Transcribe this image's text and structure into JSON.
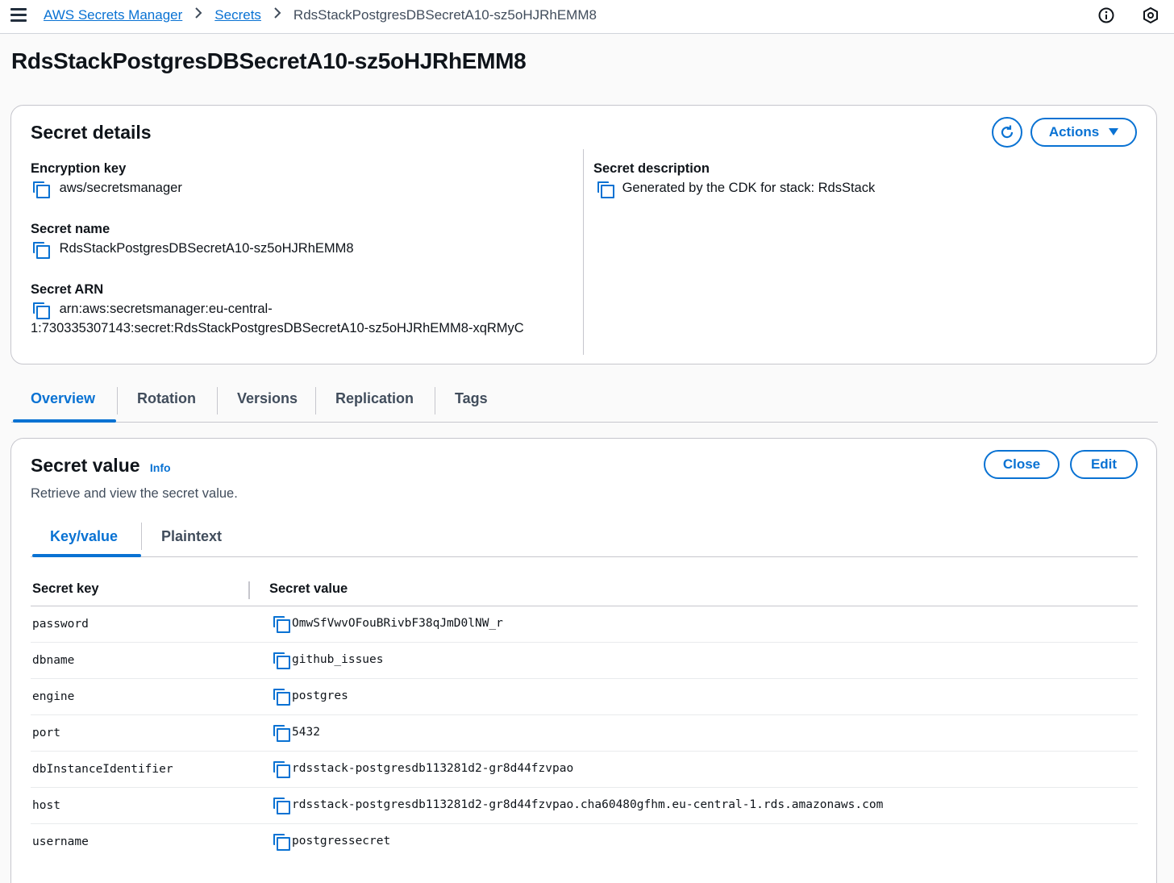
{
  "breadcrumb": {
    "root": "AWS Secrets Manager",
    "secrets": "Secrets",
    "current": "RdsStackPostgresDBSecretA10-sz5oHJRhEMM8"
  },
  "top_icons": [
    "info-circle-icon",
    "shield-hexagon-icon"
  ],
  "page_title": "RdsStackPostgresDBSecretA10-sz5oHJRhEMM8",
  "details": {
    "title": "Secret details",
    "actions_label": "Actions",
    "encryption_key_label": "Encryption key",
    "encryption_key_value": "aws/secretsmanager",
    "secret_name_label": "Secret name",
    "secret_name_value": "RdsStackPostgresDBSecretA10-sz5oHJRhEMM8",
    "secret_arn_label": "Secret ARN",
    "secret_arn_line1": "arn:aws:secretsmanager:eu-central-",
    "secret_arn_line2": "1:730335307143:secret:RdsStackPostgresDBSecretA10-sz5oHJRhEMM8-xqRMyC",
    "description_label": "Secret description",
    "description_value": "Generated by the CDK for stack: RdsStack"
  },
  "tabs": [
    "Overview",
    "Rotation",
    "Versions",
    "Replication",
    "Tags"
  ],
  "secret_value": {
    "title": "Secret value",
    "info": "Info",
    "subtitle": "Retrieve and view the secret value.",
    "close_label": "Close",
    "edit_label": "Edit",
    "subtabs": [
      "Key/value",
      "Plaintext"
    ],
    "col_key": "Secret key",
    "col_value": "Secret value",
    "rows": [
      {
        "key": "password",
        "value": "OmwSfVwvOFouBRivbF38qJmD0lNW_r"
      },
      {
        "key": "dbname",
        "value": "github_issues"
      },
      {
        "key": "engine",
        "value": "postgres"
      },
      {
        "key": "port",
        "value": "5432"
      },
      {
        "key": "dbInstanceIdentifier",
        "value": "rdsstack-postgresdb113281d2-gr8d44fzvpao"
      },
      {
        "key": "host",
        "value": "rdsstack-postgresdb113281d2-gr8d44fzvpao.cha60480gfhm.eu-central-1.rds.amazonaws.com"
      },
      {
        "key": "username",
        "value": "postgressecret"
      }
    ]
  },
  "colors": {
    "accent": "#0972d3",
    "text": "#0f141a",
    "border": "#c6c6cd"
  }
}
